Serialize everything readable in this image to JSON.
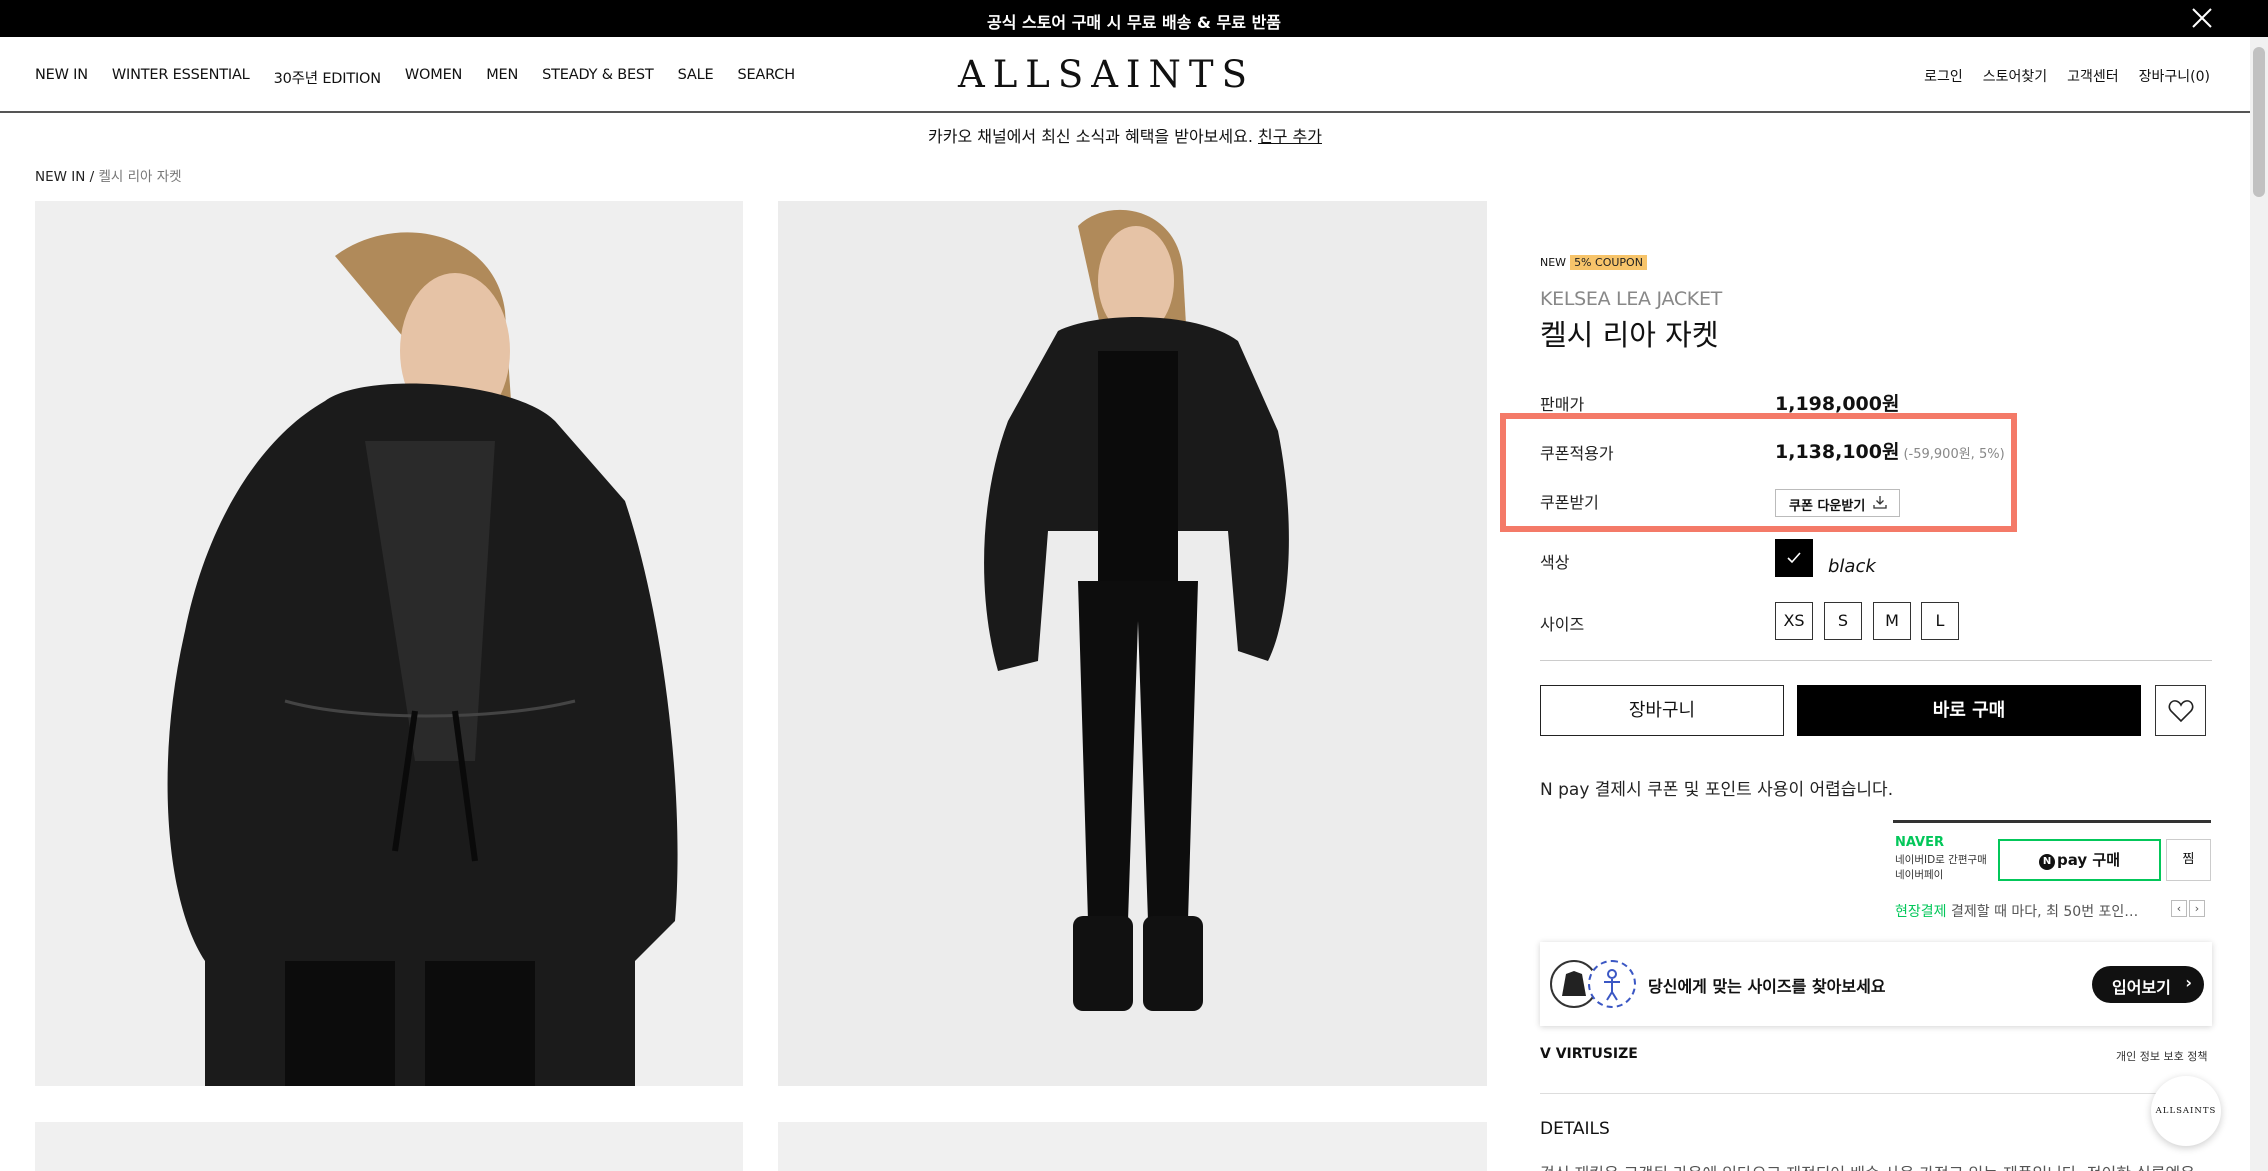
{
  "promo_banner": {
    "text": "공식 스토어 구매 시 무료 배송 & 무료 반품"
  },
  "nav": {
    "left": [
      "NEW IN",
      "WINTER ESSENTIAL",
      "30주년 EDITION",
      "WOMEN",
      "MEN",
      "STEADY & BEST",
      "SALE",
      "SEARCH"
    ],
    "logo": "ALLSAINTS",
    "right": [
      "로그인",
      "스토어찾기",
      "고객센터",
      "장바구니(0)"
    ]
  },
  "kakao": {
    "text": "카카오 채널에서 최신 소식과 혜택을 받아보세요.",
    "link": "친구 추가"
  },
  "breadcrumb": {
    "root": "NEW IN /",
    "current": "켈시 리아 자켓"
  },
  "product": {
    "badge_new": "NEW",
    "badge_coupon": "5% COUPON",
    "name_en": "KELSEA LEA JACKET",
    "name_ko": "켈시 리아 자켓",
    "sale_label": "판매가",
    "sale_price": "1,198,000원",
    "coupon_label": "쿠폰적용가",
    "coupon_price": "1,138,100원",
    "coupon_discount": "(-59,900원, 5%)",
    "coupon_dl_label": "쿠폰받기",
    "coupon_dl_button": "쿠폰 다운받기",
    "color_label": "색상",
    "color_name": "black",
    "size_label": "사이즈",
    "sizes": [
      "XS",
      "S",
      "M",
      "L"
    ],
    "cart_button": "장바구니",
    "buy_button": "바로 구매",
    "npay_note": "N pay 결제시 쿠폰 및 포인트 사용이 어렵습니다."
  },
  "npay": {
    "logo": "NAVER",
    "sub1": "네이버ID로 간편구매",
    "sub2": "네이버페이",
    "button": "pay 구매",
    "zzim": "찜",
    "onsite_label": "현장결제",
    "onsite_text": "결제할 때 마다, 최 50번 포인…"
  },
  "virtusize": {
    "text": "당신에게 맞는 사이즈를 찾아보세요",
    "button": "입어보기",
    "logo": "VIRTUSIZE",
    "privacy": "개인 정보 보호 정책"
  },
  "details": {
    "title": "DETAILS",
    "text": "겉신 재킷은 고객된 라운에 있다으고 재정되어 배솜 사용 가정고 있는 제품입니다. 전이한 실루엣은"
  },
  "float_logo": "ALLSAINTS",
  "colors": {
    "highlight": "#f47a68",
    "naver_green": "#03c75a",
    "coupon_badge": "#f7c46a"
  }
}
